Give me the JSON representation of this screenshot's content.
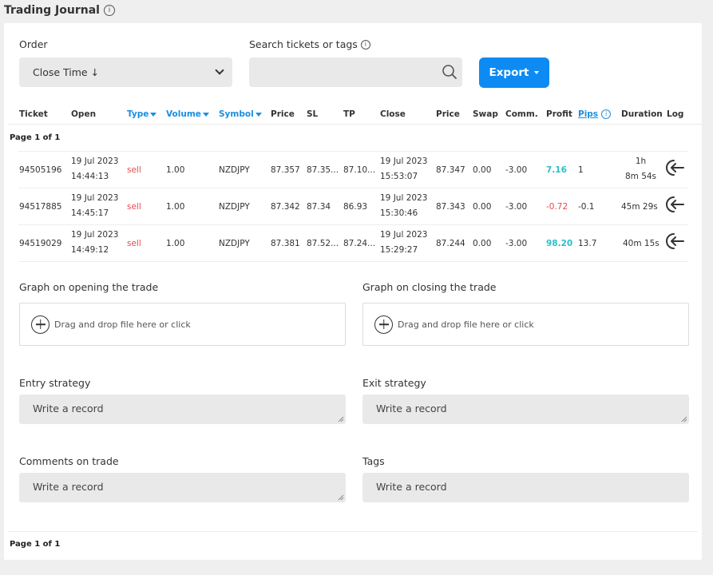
{
  "app": {
    "title": "Trading Journal"
  },
  "filters": {
    "order_label": "Order",
    "order_value": "Close Time ↓",
    "search_label": "Search tickets or tags",
    "search_value": "",
    "export_label": "Export"
  },
  "table": {
    "headers": [
      "Ticket",
      "Open",
      "Type",
      "Volume",
      "Symbol",
      "Price",
      "SL",
      "TP",
      "Close",
      "Price",
      "Swap",
      "Comm.",
      "Profit",
      "Pips",
      "Duration",
      "Log"
    ],
    "page_info_top": "Page 1 of 1",
    "page_info_bottom": "Page 1 of 1",
    "rows": [
      {
        "ticket": "94505196",
        "open_date": "19 Jul 2023",
        "open_time": "14:44:13",
        "type": "sell",
        "volume": "1.00",
        "symbol": "NZDJPY",
        "open_price": "87.357",
        "sl": "87.35...",
        "tp": "87.10...",
        "close_date": "19 Jul 2023",
        "close_time": "15:53:07",
        "close_price": "87.347",
        "swap": "0.00",
        "comm": "-3.00",
        "profit": "7.16",
        "pips": "1",
        "duration_line1": "1h",
        "duration_line2": "8m 54s"
      },
      {
        "ticket": "94517885",
        "open_date": "19 Jul 2023",
        "open_time": "14:45:17",
        "type": "sell",
        "volume": "1.00",
        "symbol": "NZDJPY",
        "open_price": "87.342",
        "sl": "87.34",
        "tp": "86.93",
        "close_date": "19 Jul 2023",
        "close_time": "15:30:46",
        "close_price": "87.343",
        "swap": "0.00",
        "comm": "-3.00",
        "profit": "-0.72",
        "pips": "-0.1",
        "duration_line1": "45m 29s",
        "duration_line2": ""
      },
      {
        "ticket": "94519029",
        "open_date": "19 Jul 2023",
        "open_time": "14:49:12",
        "type": "sell",
        "volume": "1.00",
        "symbol": "NZDJPY",
        "open_price": "87.381",
        "sl": "87.52...",
        "tp": "87.24...",
        "close_date": "19 Jul 2023",
        "close_time": "15:29:27",
        "close_price": "87.244",
        "swap": "0.00",
        "comm": "-3.00",
        "profit": "98.20",
        "pips": "13.7",
        "duration_line1": "40m 15s",
        "duration_line2": ""
      }
    ]
  },
  "uploads": {
    "open_graph_label": "Graph on opening the trade",
    "close_graph_label": "Graph on closing the trade",
    "drop_text": "Drag and drop file here or click"
  },
  "notes": {
    "entry_label": "Entry strategy",
    "exit_label": "Exit strategy",
    "comments_label": "Comments on trade",
    "tags_label": "Tags",
    "placeholder": "Write a record"
  },
  "colors": {
    "accent": "#0d8bf2",
    "sort_link": "#1a8fe0",
    "sell": "#e5484d",
    "profit_positive": "#2bbfc7",
    "profit_negative": "#e5484d"
  },
  "icons": {
    "info": "info-icon",
    "search": "search-icon",
    "log": "log-exit-icon",
    "add": "plus-circle-icon",
    "chevron": "chevron-down-icon"
  }
}
